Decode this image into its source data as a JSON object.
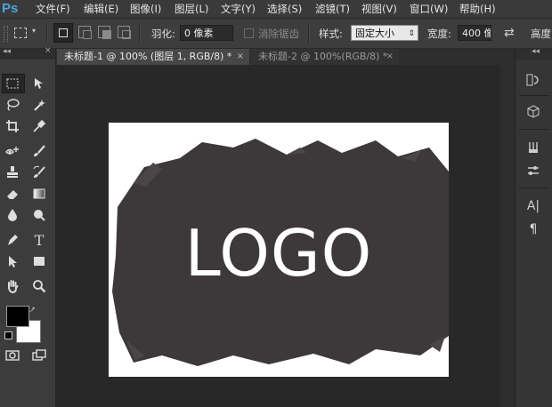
{
  "app": {
    "logo": "Ps"
  },
  "menu": [
    "文件(F)",
    "编辑(E)",
    "图像(I)",
    "图层(L)",
    "文字(Y)",
    "选择(S)",
    "滤镜(T)",
    "视图(V)",
    "窗口(W)",
    "帮助(H)"
  ],
  "options": {
    "feather_label": "羽化:",
    "feather_value": "0 像素",
    "antialias_label": "消除锯齿",
    "style_label": "样式:",
    "style_value": "固定大小",
    "width_label": "宽度:",
    "width_value": "400 像",
    "height_label": "高度"
  },
  "tabs": [
    {
      "label": "未标题-1 @ 100% (图层 1, RGB/8) *",
      "active": true
    },
    {
      "label": "未标题-2 @ 100%(RGB/8) *",
      "active": false
    }
  ],
  "canvas": {
    "text": "LOGO",
    "brush_color": "#3d393a"
  },
  "colors": {
    "foreground": "#000000",
    "background": "#ffffff"
  }
}
